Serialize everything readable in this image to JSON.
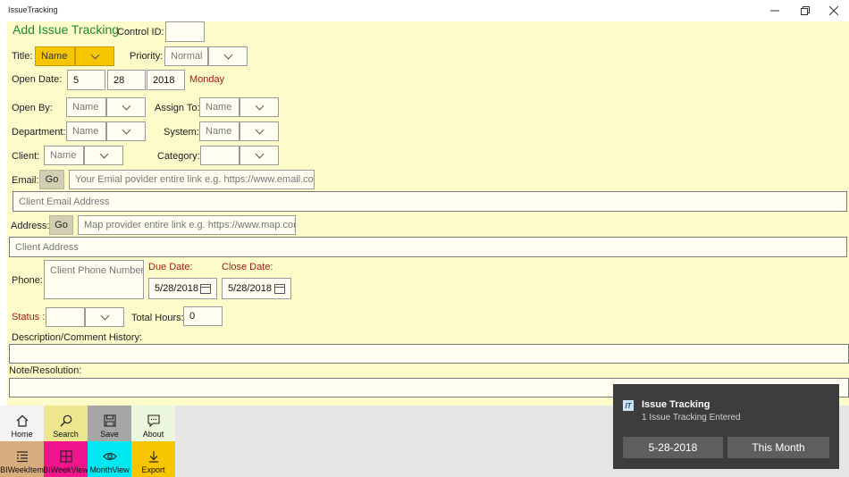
{
  "window": {
    "title": "IssueTracking"
  },
  "form": {
    "heading": "Add Issue Tracking",
    "control_id_label": "Control ID:",
    "control_id_value": "",
    "title_label": "Title:",
    "title_value": "Name",
    "priority_label": "Priority:",
    "priority_value": "Normal",
    "open_date_label": "Open Date:",
    "open_month": "5",
    "open_day": "28",
    "open_year": "2018",
    "open_weekday": "Monday",
    "open_by_label": "Open By:",
    "open_by_placeholder": "Name",
    "assign_to_label": "Assign To:",
    "assign_to_placeholder": "Name",
    "department_label": "Department:",
    "department_placeholder": "Name",
    "system_label": "System:",
    "system_placeholder": "Name",
    "client_label": "Client:",
    "client_placeholder": "Name",
    "category_label": "Category:",
    "category_value": "",
    "email_label": "Email:",
    "email_go": "Go",
    "email_provider_placeholder": "Your Emial povider entire link e.g. https://www.email.com",
    "client_email_placeholder": "Client Email Address",
    "address_label": "Address:",
    "address_go": "Go",
    "map_provider_placeholder": "Map provider entire link e.g. https://www.map.com",
    "client_address_placeholder": "Client Address",
    "phone_label": "Phone:",
    "phone_placeholder": "Client Phone Number",
    "due_date_label": "Due Date:",
    "due_date_value": "5/28/2018",
    "close_date_label": "Close Date:",
    "close_date_value": "5/28/2018",
    "status_label": "Status :",
    "status_value": "",
    "total_hours_label": "Total Hours:",
    "total_hours_value": "0",
    "description_label": "Description/Comment History:",
    "description_value": "",
    "note_label": "Note/Resolution:",
    "note_value": ""
  },
  "nav": {
    "home": "Home",
    "search": "Search",
    "save": "Save",
    "about": "About",
    "biweek_item": "BIWeekItem",
    "biweek_view": "BIWeekView",
    "month_view": "MonthView",
    "export": "Export"
  },
  "toast": {
    "icon_text": "IT",
    "title": "Issue Tracking",
    "body": "1 Issue Tracking Entered",
    "btn_date": "5-28-2018",
    "btn_month": "This Month"
  },
  "colors": {
    "form_bg": "#fdfbc9",
    "accent_gold": "#f7c600",
    "heading_green": "#1f8a2a",
    "red_label": "#a11c1c",
    "search_tile": "#ede68e",
    "save_tile": "#a6a6a6",
    "about_tile": "#eaf7dc",
    "home_tile": "#f3f3f3",
    "biweekitem_tile": "#d8ad7d",
    "biweekview_tile": "#f0148d",
    "monthview_tile": "#00e8f2",
    "export_tile": "#f7c600"
  },
  "icons": {
    "minimize": "minimize-icon",
    "maximize": "restore-icon",
    "close": "close-icon",
    "calendar": "calendar-icon",
    "chevron": "chevron-down-icon"
  }
}
